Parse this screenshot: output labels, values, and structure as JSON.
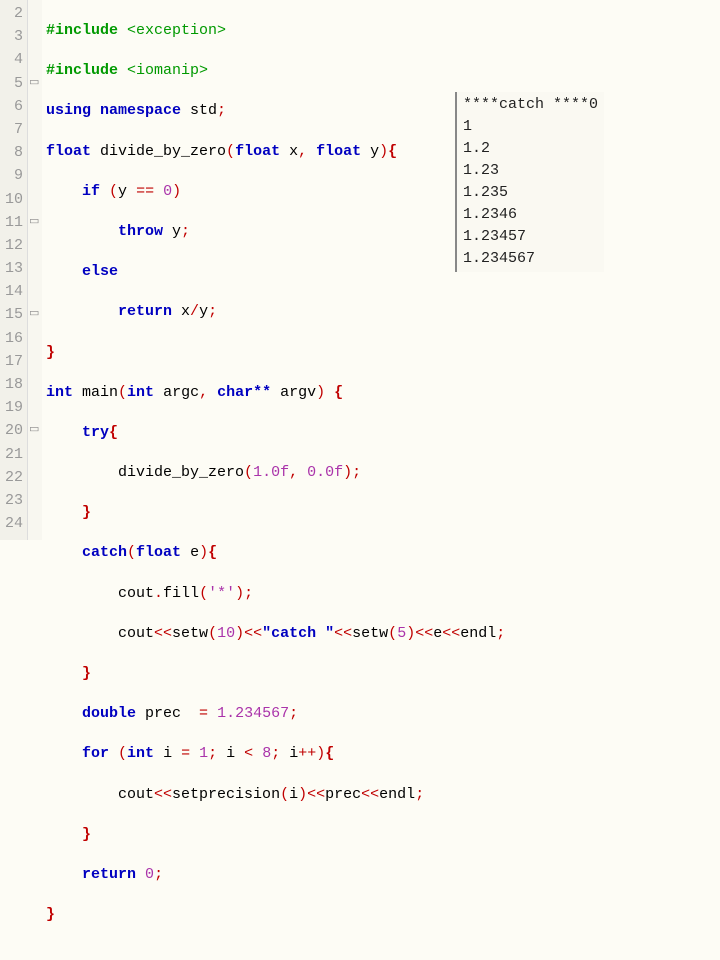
{
  "gutter": [
    "2",
    "3",
    "4",
    "5",
    "6",
    "7",
    "8",
    "9",
    "10",
    "11",
    "12",
    "13",
    "14",
    "15",
    "16",
    "17",
    "18",
    "19",
    "20",
    "21",
    "22",
    "23",
    "24"
  ],
  "fold": [
    "",
    "",
    "",
    "▭",
    "",
    "",
    "",
    "",
    "",
    "▭",
    "",
    "",
    "",
    "▭",
    "",
    "",
    "",
    "",
    "▭",
    "",
    "",
    "",
    ""
  ],
  "code": {
    "l2a": "#include ",
    "l2b": "<exception>",
    "l3a": "#include ",
    "l3b": "<iomanip>",
    "l4a": "using ",
    "l4b": "namespace",
    "l4c": " std",
    "l4d": ";",
    "l5a": "float",
    "l5b": " divide_by_zero",
    "l5c": "(",
    "l5d": "float",
    "l5e": " x",
    "l5f": ",",
    "l5g": " ",
    "l5h": "float",
    "l5i": " y",
    "l5j": ")",
    "l5k": "{",
    "l6a": "if ",
    "l6b": "(",
    "l6c": "y ",
    "l6d": "==",
    "l6e": " ",
    "l6f": "0",
    "l6g": ")",
    "l7a": "throw",
    "l7b": " y",
    "l7c": ";",
    "l8a": "else",
    "l9a": "return",
    "l9b": " x",
    "l9c": "/",
    "l9d": "y",
    "l9e": ";",
    "l10a": "}",
    "l11a": "int",
    "l11b": " main",
    "l11c": "(",
    "l11d": "int",
    "l11e": " argc",
    "l11f": ",",
    "l11g": " ",
    "l11h": "char**",
    "l11i": " argv",
    "l11j": ")",
    "l11k": " ",
    "l11l": "{",
    "l12a": "try",
    "l12b": "{",
    "l13a": "divide_by_zero",
    "l13b": "(",
    "l13c": "1.0f",
    "l13d": ",",
    "l13e": " ",
    "l13f": "0.0f",
    "l13g": ")",
    "l13h": ";",
    "l14a": "}",
    "l15a": "catch",
    "l15b": "(",
    "l15c": "float",
    "l15d": " e",
    "l15e": ")",
    "l15f": "{",
    "l16a": "cout",
    "l16b": ".",
    "l16c": "fill",
    "l16d": "(",
    "l16e": "'*'",
    "l16f": ")",
    "l16g": ";",
    "l17a": "cout",
    "l17b": "<<",
    "l17c": "setw",
    "l17d": "(",
    "l17e": "10",
    "l17f": ")",
    "l17g": "<<",
    "l17h": "\"catch \"",
    "l17i": "<<",
    "l17j": "setw",
    "l17k": "(",
    "l17l": "5",
    "l17m": ")",
    "l17n": "<<",
    "l17o": "e",
    "l17p": "<<",
    "l17q": "endl",
    "l17r": ";",
    "l18a": "}",
    "l19a": "double",
    "l19b": " prec  ",
    "l19c": "=",
    "l19d": " ",
    "l19e": "1.234567",
    "l19f": ";",
    "l20a": "for ",
    "l20b": "(",
    "l20c": "int",
    "l20d": " i ",
    "l20e": "=",
    "l20f": " ",
    "l20g": "1",
    "l20h": ";",
    "l20i": " i ",
    "l20j": "<",
    "l20k": " ",
    "l20l": "8",
    "l20m": ";",
    "l20n": " i",
    "l20o": "++",
    "l20p": ")",
    "l20q": "{",
    "l21a": "cout",
    "l21b": "<<",
    "l21c": "setprecision",
    "l21d": "(",
    "l21e": "i",
    "l21f": ")",
    "l21g": "<<",
    "l21h": "prec",
    "l21i": "<<",
    "l21j": "endl",
    "l21k": ";",
    "l22a": "}",
    "l23a": "return",
    "l23b": " ",
    "l23c": "0",
    "l23d": ";",
    "l24a": "}"
  },
  "output": [
    "****catch ****0",
    "1",
    "1.2",
    "1.23",
    "1.235",
    "1.2346",
    "1.23457",
    "1.234567"
  ]
}
